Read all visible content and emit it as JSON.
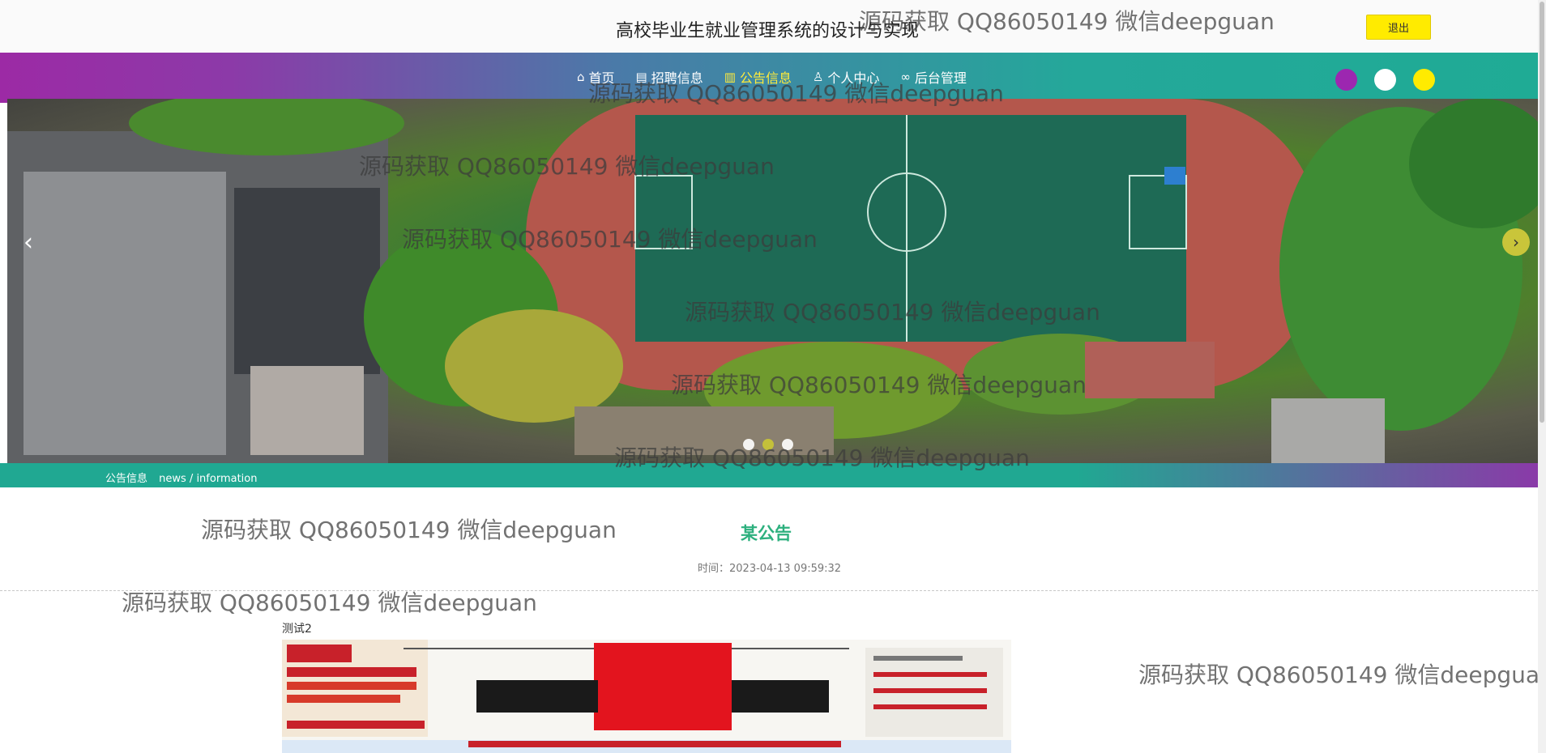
{
  "header": {
    "title": "高校毕业生就业管理系统的设计与实现",
    "logout_label": "退出"
  },
  "nav": {
    "items": [
      {
        "label": "首页",
        "icon": "home-icon"
      },
      {
        "label": "招聘信息",
        "icon": "document-icon"
      },
      {
        "label": "公告信息",
        "icon": "notice-icon",
        "active": true
      },
      {
        "label": "个人中心",
        "icon": "user-icon"
      },
      {
        "label": "后台管理",
        "icon": "link-icon"
      }
    ]
  },
  "theme_colors": [
    "#9c27b0",
    "#ffffff",
    "#ffeb00"
  ],
  "breadcrumb": {
    "label": "公告信息",
    "subtitle": "news / information"
  },
  "notice": {
    "title": "某公告",
    "time": "时间：2023-04-13 09:59:32",
    "body": "测试2"
  },
  "watermark": "源码获取 QQ86050149 微信deepguan"
}
